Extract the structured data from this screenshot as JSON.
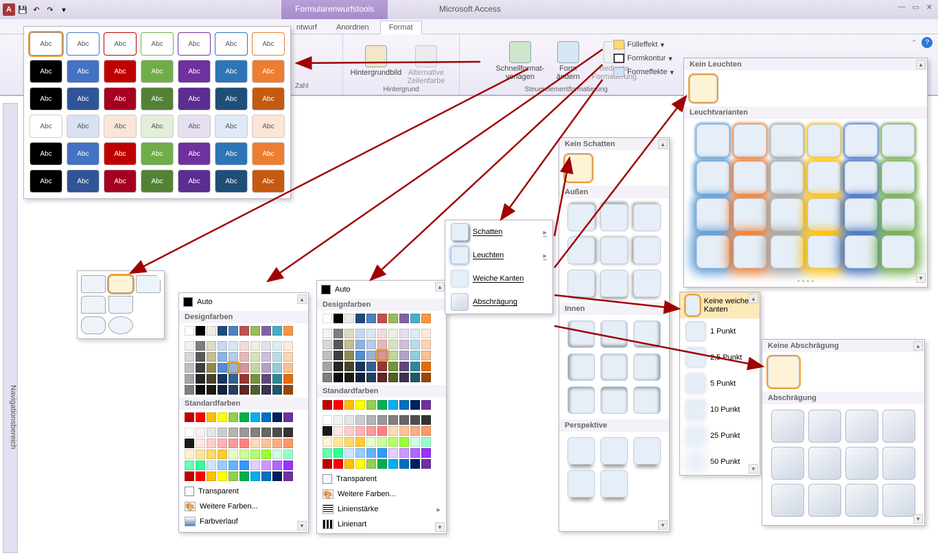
{
  "titlebar": {
    "tools_tab": "Formularenwurfstools",
    "app_name": "Microsoft Access"
  },
  "ribbon_tabs": {
    "t1": "ntwurf",
    "t2": "Anordnen",
    "t3": "Format"
  },
  "ribbon": {
    "zahl": "Zahl",
    "hintergrundbild": "Hintergrundbild",
    "alt_zeilenfarbe_1": "Alternative",
    "alt_zeilenfarbe_2": "Zeilenfarbe",
    "hintergrund_group": "Hintergrund",
    "schnellformat_1": "Schnellformat-",
    "schnellformat_2": "vorlagen",
    "formaendern_1": "Form",
    "formaendern_2": "ändern",
    "bedingte_1": "Bedingte",
    "bedingte_2": "Formatierung",
    "fuelleffekt": "Fülleffekt",
    "formkontur": "Formkontur",
    "formeffekte": "Formeffekte",
    "steuerelement_group": "Steuerelementformatierung"
  },
  "navpane": "Navigationsbereich",
  "styles": {
    "swatch_label": "Abc"
  },
  "colorpicker": {
    "auto": "Auto",
    "designfarben": "Designfarben",
    "standardfarben": "Standardfarben",
    "transparent": "Transparent",
    "weitere": "Weitere Farben...",
    "farbverlauf": "Farbverlauf",
    "linienstaerke": "Linienstärke",
    "linienart": "Linienart"
  },
  "effects_menu": {
    "schatten": "Schatten",
    "leuchten": "Leuchten",
    "weiche_kanten": "Weiche Kanten",
    "abschraegung": "Abschrägung"
  },
  "shadow": {
    "kein": "Kein Schatten",
    "aussen": "Außen",
    "innen": "Innen",
    "perspektive": "Perspektive"
  },
  "glow": {
    "kein": "Kein Leuchten",
    "varianten": "Leuchtvarianten"
  },
  "soft": {
    "keine": "Keine weichen Kanten",
    "p1": "1 Punkt",
    "p25": "2,5 Punkt",
    "p5": "5 Punkt",
    "p10": "10 Punkt",
    "p25_": "25 Punkt",
    "p50": "50 Punkt"
  },
  "bevel": {
    "keine": "Keine Abschrägung",
    "abschraegung": "Abschrägung"
  },
  "style_colors": [
    [
      "#fff",
      "#fff",
      "#fff",
      "#fff",
      "#fff",
      "#fff",
      "#fff"
    ],
    [
      "#000",
      "#4472c4",
      "#c00000",
      "#70ad47",
      "#7030a0",
      "#2e75b6",
      "#ed7d31"
    ],
    [
      "#000",
      "#2f5597",
      "#a50021",
      "#548235",
      "#5b2d90",
      "#1f4e79",
      "#c55a11"
    ],
    [
      "#fff",
      "#d9e2f3",
      "#fbe5d6",
      "#e2efda",
      "#e6dff1",
      "#deebf7",
      "#fbe5d6"
    ],
    [
      "#000",
      "#4472c4",
      "#c00000",
      "#70ad47",
      "#7030a0",
      "#2e75b6",
      "#ed7d31"
    ],
    [
      "#000",
      "#2f5597",
      "#a50021",
      "#548235",
      "#5b2d90",
      "#1f4e79",
      "#c55a11"
    ]
  ],
  "theme_colors": [
    "#ffffff",
    "#000000",
    "#eeece1",
    "#1f497d",
    "#4f81bd",
    "#c0504d",
    "#9bbb59",
    "#8064a2",
    "#4bacc6",
    "#f79646"
  ],
  "theme_tints": [
    [
      "#f2f2f2",
      "#7f7f7f",
      "#ddd9c3",
      "#c6d9f0",
      "#dbe5f1",
      "#f2dcdb",
      "#ebf1dd",
      "#e5e0ec",
      "#dbeef3",
      "#fdeada"
    ],
    [
      "#d8d8d8",
      "#595959",
      "#c4bd97",
      "#8db3e2",
      "#b8cce4",
      "#e5b9b7",
      "#d7e3bc",
      "#ccc1d9",
      "#b7dde8",
      "#fbd5b5"
    ],
    [
      "#bfbfbf",
      "#3f3f3f",
      "#938953",
      "#548dd4",
      "#95b3d7",
      "#d99694",
      "#c3d69b",
      "#b2a2c7",
      "#92cddc",
      "#fac08f"
    ],
    [
      "#a5a5a5",
      "#262626",
      "#494429",
      "#17365d",
      "#366092",
      "#953734",
      "#76923c",
      "#5f497a",
      "#31859b",
      "#e36c09"
    ],
    [
      "#7f7f7f",
      "#0c0c0c",
      "#1d1b10",
      "#0f243e",
      "#244061",
      "#632423",
      "#4f6128",
      "#3f3151",
      "#205867",
      "#974806"
    ]
  ],
  "std_colors_row": [
    "#c00000",
    "#ff0000",
    "#ffc000",
    "#ffff00",
    "#92d050",
    "#00b050",
    "#00b0f0",
    "#0070c0",
    "#002060",
    "#7030a0"
  ],
  "extra_colors": [
    [
      "#ffffff",
      "#f2f2f2",
      "#e6e6e6",
      "#cccccc",
      "#b3b3b3",
      "#999999",
      "#808080",
      "#666666",
      "#4d4d4d",
      "#333333"
    ],
    [
      "#1a1a1a",
      "#ffe6e6",
      "#ffcccc",
      "#ffb3b3",
      "#ff9999",
      "#ff8080",
      "#ffd9b3",
      "#ffc299",
      "#ffad80",
      "#ff9966"
    ],
    [
      "#fff2cc",
      "#ffe699",
      "#ffd966",
      "#ffcc33",
      "#e6ffcc",
      "#ccff99",
      "#b3ff66",
      "#99ff33",
      "#ccffe6",
      "#99ffcc"
    ],
    [
      "#66ffb3",
      "#33ff99",
      "#cce6ff",
      "#99ccff",
      "#66b3ff",
      "#3399ff",
      "#e6ccff",
      "#cc99ff",
      "#b366ff",
      "#9933ff"
    ],
    [
      "#c00000",
      "#ff0000",
      "#ffc000",
      "#ffff00",
      "#92d050",
      "#00b050",
      "#00b0f0",
      "#0070c0",
      "#002060",
      "#7030a0"
    ]
  ],
  "glow_colors": [
    "#5b9bd5",
    "#ed7d31",
    "#a5a5a5",
    "#ffc000",
    "#4472c4",
    "#70ad47"
  ]
}
